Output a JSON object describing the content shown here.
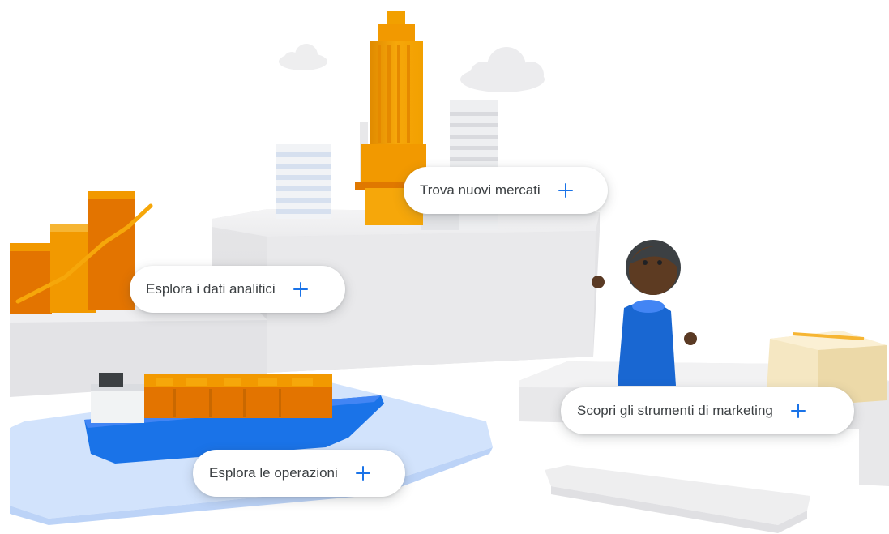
{
  "hotspots": [
    {
      "id": "mercati",
      "label": "Trova nuovi mercati",
      "icon": "plus-icon"
    },
    {
      "id": "dati",
      "label": "Esplora i dati analitici",
      "icon": "plus-icon"
    },
    {
      "id": "marketing",
      "label": "Scopri gli strumenti di marketing",
      "icon": "plus-icon"
    },
    {
      "id": "operazioni",
      "label": "Esplora le operazioni",
      "icon": "plus-icon"
    }
  ],
  "colors": {
    "accent": "#1a73e8",
    "orange": "#f29900",
    "dark_orange": "#e37400",
    "person_top": "#1967d2",
    "water": "#d2e3fc"
  }
}
